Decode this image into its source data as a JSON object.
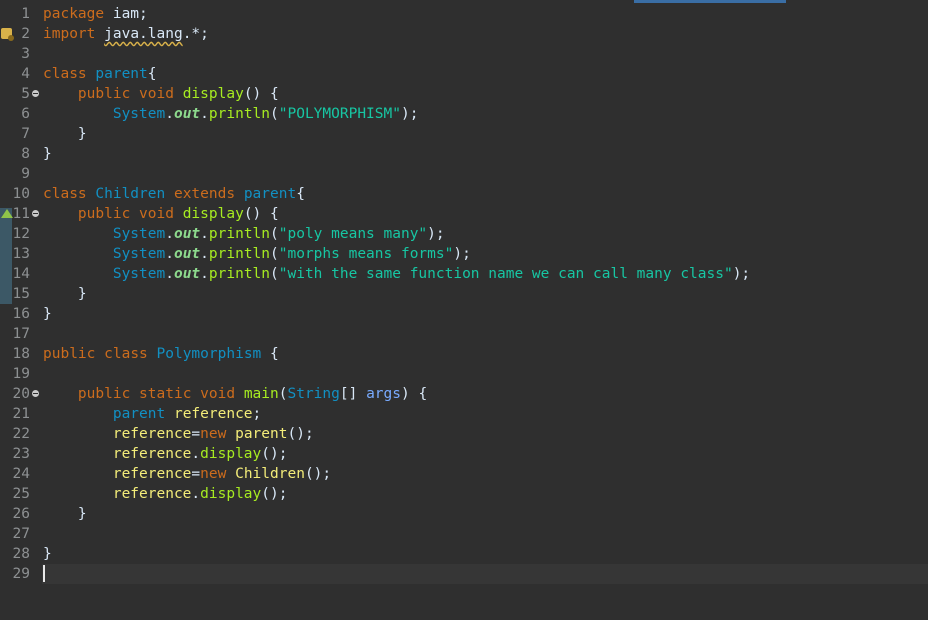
{
  "editor": {
    "current_line": 29,
    "colors": {
      "background": "#2f2f2f",
      "current_line": "#363636",
      "keyword": "#cc6c1d",
      "type": "#1290c3",
      "method": "#a7ec21",
      "string": "#17c6a3",
      "variable": "#f3ec79",
      "field": "#8dda8d",
      "parameter": "#79abff",
      "plain": "#d9e8f7",
      "line_number": "#8d9092"
    },
    "lines": [
      {
        "number": "1",
        "tokens": [
          {
            "t": "package",
            "c": "kw"
          },
          {
            "t": " iam;",
            "c": "plain"
          }
        ]
      },
      {
        "number": "2",
        "marker": "warning-icon",
        "tokens": [
          {
            "t": "import",
            "c": "kw"
          },
          {
            "t": " ",
            "c": "plain"
          },
          {
            "t": "java.lang",
            "c": "plain",
            "underline": true
          },
          {
            "t": ".*;",
            "c": "plain"
          }
        ]
      },
      {
        "number": "3",
        "tokens": []
      },
      {
        "number": "4",
        "tokens": [
          {
            "t": "class",
            "c": "kw"
          },
          {
            "t": " ",
            "c": "plain"
          },
          {
            "t": "parent",
            "c": "type"
          },
          {
            "t": "{",
            "c": "plain"
          }
        ]
      },
      {
        "number": "5",
        "fold": true,
        "tokens": [
          {
            "t": "    ",
            "c": "plain"
          },
          {
            "t": "public",
            "c": "kw"
          },
          {
            "t": " ",
            "c": "plain"
          },
          {
            "t": "void",
            "c": "kw"
          },
          {
            "t": " ",
            "c": "plain"
          },
          {
            "t": "display",
            "c": "method"
          },
          {
            "t": "() {",
            "c": "plain"
          }
        ]
      },
      {
        "number": "6",
        "tokens": [
          {
            "t": "        ",
            "c": "plain"
          },
          {
            "t": "System",
            "c": "type"
          },
          {
            "t": ".",
            "c": "plain"
          },
          {
            "t": "out",
            "c": "field"
          },
          {
            "t": ".",
            "c": "plain"
          },
          {
            "t": "println",
            "c": "method"
          },
          {
            "t": "(",
            "c": "plain"
          },
          {
            "t": "\"POLYMORPHISM\"",
            "c": "string"
          },
          {
            "t": ");",
            "c": "plain"
          }
        ]
      },
      {
        "number": "7",
        "tokens": [
          {
            "t": "    }",
            "c": "plain"
          }
        ]
      },
      {
        "number": "8",
        "tokens": [
          {
            "t": "}",
            "c": "plain"
          }
        ]
      },
      {
        "number": "9",
        "tokens": []
      },
      {
        "number": "10",
        "tokens": [
          {
            "t": "class",
            "c": "kw"
          },
          {
            "t": " ",
            "c": "plain"
          },
          {
            "t": "Children",
            "c": "type"
          },
          {
            "t": " ",
            "c": "plain"
          },
          {
            "t": "extends",
            "c": "kw"
          },
          {
            "t": " ",
            "c": "plain"
          },
          {
            "t": "parent",
            "c": "type"
          },
          {
            "t": "{",
            "c": "plain"
          }
        ]
      },
      {
        "number": "11",
        "fold": true,
        "marker": "override-icon",
        "tokens": [
          {
            "t": "    ",
            "c": "plain"
          },
          {
            "t": "public",
            "c": "kw"
          },
          {
            "t": " ",
            "c": "plain"
          },
          {
            "t": "void",
            "c": "kw"
          },
          {
            "t": " ",
            "c": "plain"
          },
          {
            "t": "display",
            "c": "method"
          },
          {
            "t": "() {",
            "c": "plain"
          }
        ]
      },
      {
        "number": "12",
        "tokens": [
          {
            "t": "        ",
            "c": "plain"
          },
          {
            "t": "System",
            "c": "type"
          },
          {
            "t": ".",
            "c": "plain"
          },
          {
            "t": "out",
            "c": "field"
          },
          {
            "t": ".",
            "c": "plain"
          },
          {
            "t": "println",
            "c": "method"
          },
          {
            "t": "(",
            "c": "plain"
          },
          {
            "t": "\"poly means many\"",
            "c": "string"
          },
          {
            "t": ");",
            "c": "plain"
          }
        ]
      },
      {
        "number": "13",
        "tokens": [
          {
            "t": "        ",
            "c": "plain"
          },
          {
            "t": "System",
            "c": "type"
          },
          {
            "t": ".",
            "c": "plain"
          },
          {
            "t": "out",
            "c": "field"
          },
          {
            "t": ".",
            "c": "plain"
          },
          {
            "t": "println",
            "c": "method"
          },
          {
            "t": "(",
            "c": "plain"
          },
          {
            "t": "\"morphs means forms\"",
            "c": "string"
          },
          {
            "t": ");",
            "c": "plain"
          }
        ]
      },
      {
        "number": "14",
        "tokens": [
          {
            "t": "        ",
            "c": "plain"
          },
          {
            "t": "System",
            "c": "type"
          },
          {
            "t": ".",
            "c": "plain"
          },
          {
            "t": "out",
            "c": "field"
          },
          {
            "t": ".",
            "c": "plain"
          },
          {
            "t": "println",
            "c": "method"
          },
          {
            "t": "(",
            "c": "plain"
          },
          {
            "t": "\"with the same function name we can call many class\"",
            "c": "string"
          },
          {
            "t": ");",
            "c": "plain"
          }
        ]
      },
      {
        "number": "15",
        "tokens": [
          {
            "t": "    }",
            "c": "plain"
          }
        ]
      },
      {
        "number": "16",
        "tokens": [
          {
            "t": "}",
            "c": "plain"
          }
        ]
      },
      {
        "number": "17",
        "tokens": []
      },
      {
        "number": "18",
        "tokens": [
          {
            "t": "public",
            "c": "kw"
          },
          {
            "t": " ",
            "c": "plain"
          },
          {
            "t": "class",
            "c": "kw"
          },
          {
            "t": " ",
            "c": "plain"
          },
          {
            "t": "Polymorphism",
            "c": "type"
          },
          {
            "t": " {",
            "c": "plain"
          }
        ]
      },
      {
        "number": "19",
        "tokens": []
      },
      {
        "number": "20",
        "fold": true,
        "tokens": [
          {
            "t": "    ",
            "c": "plain"
          },
          {
            "t": "public",
            "c": "kw"
          },
          {
            "t": " ",
            "c": "plain"
          },
          {
            "t": "static",
            "c": "kw"
          },
          {
            "t": " ",
            "c": "plain"
          },
          {
            "t": "void",
            "c": "kw"
          },
          {
            "t": " ",
            "c": "plain"
          },
          {
            "t": "main",
            "c": "method"
          },
          {
            "t": "(",
            "c": "plain"
          },
          {
            "t": "String",
            "c": "type"
          },
          {
            "t": "[] ",
            "c": "plain"
          },
          {
            "t": "args",
            "c": "param"
          },
          {
            "t": ") {",
            "c": "plain"
          }
        ]
      },
      {
        "number": "21",
        "tokens": [
          {
            "t": "        ",
            "c": "plain"
          },
          {
            "t": "parent",
            "c": "type"
          },
          {
            "t": " ",
            "c": "plain"
          },
          {
            "t": "reference",
            "c": "var"
          },
          {
            "t": ";",
            "c": "plain"
          }
        ]
      },
      {
        "number": "22",
        "tokens": [
          {
            "t": "        ",
            "c": "plain"
          },
          {
            "t": "reference",
            "c": "var"
          },
          {
            "t": "=",
            "c": "plain"
          },
          {
            "t": "new",
            "c": "kw"
          },
          {
            "t": " ",
            "c": "plain"
          },
          {
            "t": "parent",
            "c": "var"
          },
          {
            "t": "();",
            "c": "plain"
          }
        ]
      },
      {
        "number": "23",
        "tokens": [
          {
            "t": "        ",
            "c": "plain"
          },
          {
            "t": "reference",
            "c": "var"
          },
          {
            "t": ".",
            "c": "plain"
          },
          {
            "t": "display",
            "c": "method"
          },
          {
            "t": "();",
            "c": "plain"
          }
        ]
      },
      {
        "number": "24",
        "tokens": [
          {
            "t": "        ",
            "c": "plain"
          },
          {
            "t": "reference",
            "c": "var"
          },
          {
            "t": "=",
            "c": "plain"
          },
          {
            "t": "new",
            "c": "kw"
          },
          {
            "t": " ",
            "c": "plain"
          },
          {
            "t": "Children",
            "c": "var"
          },
          {
            "t": "();",
            "c": "plain"
          }
        ]
      },
      {
        "number": "25",
        "tokens": [
          {
            "t": "        ",
            "c": "plain"
          },
          {
            "t": "reference",
            "c": "var"
          },
          {
            "t": ".",
            "c": "plain"
          },
          {
            "t": "display",
            "c": "method"
          },
          {
            "t": "();",
            "c": "plain"
          }
        ]
      },
      {
        "number": "26",
        "tokens": [
          {
            "t": "    }",
            "c": "plain"
          }
        ]
      },
      {
        "number": "27",
        "tokens": []
      },
      {
        "number": "28",
        "tokens": [
          {
            "t": "}",
            "c": "plain"
          }
        ]
      },
      {
        "number": "29",
        "tokens": []
      }
    ]
  }
}
